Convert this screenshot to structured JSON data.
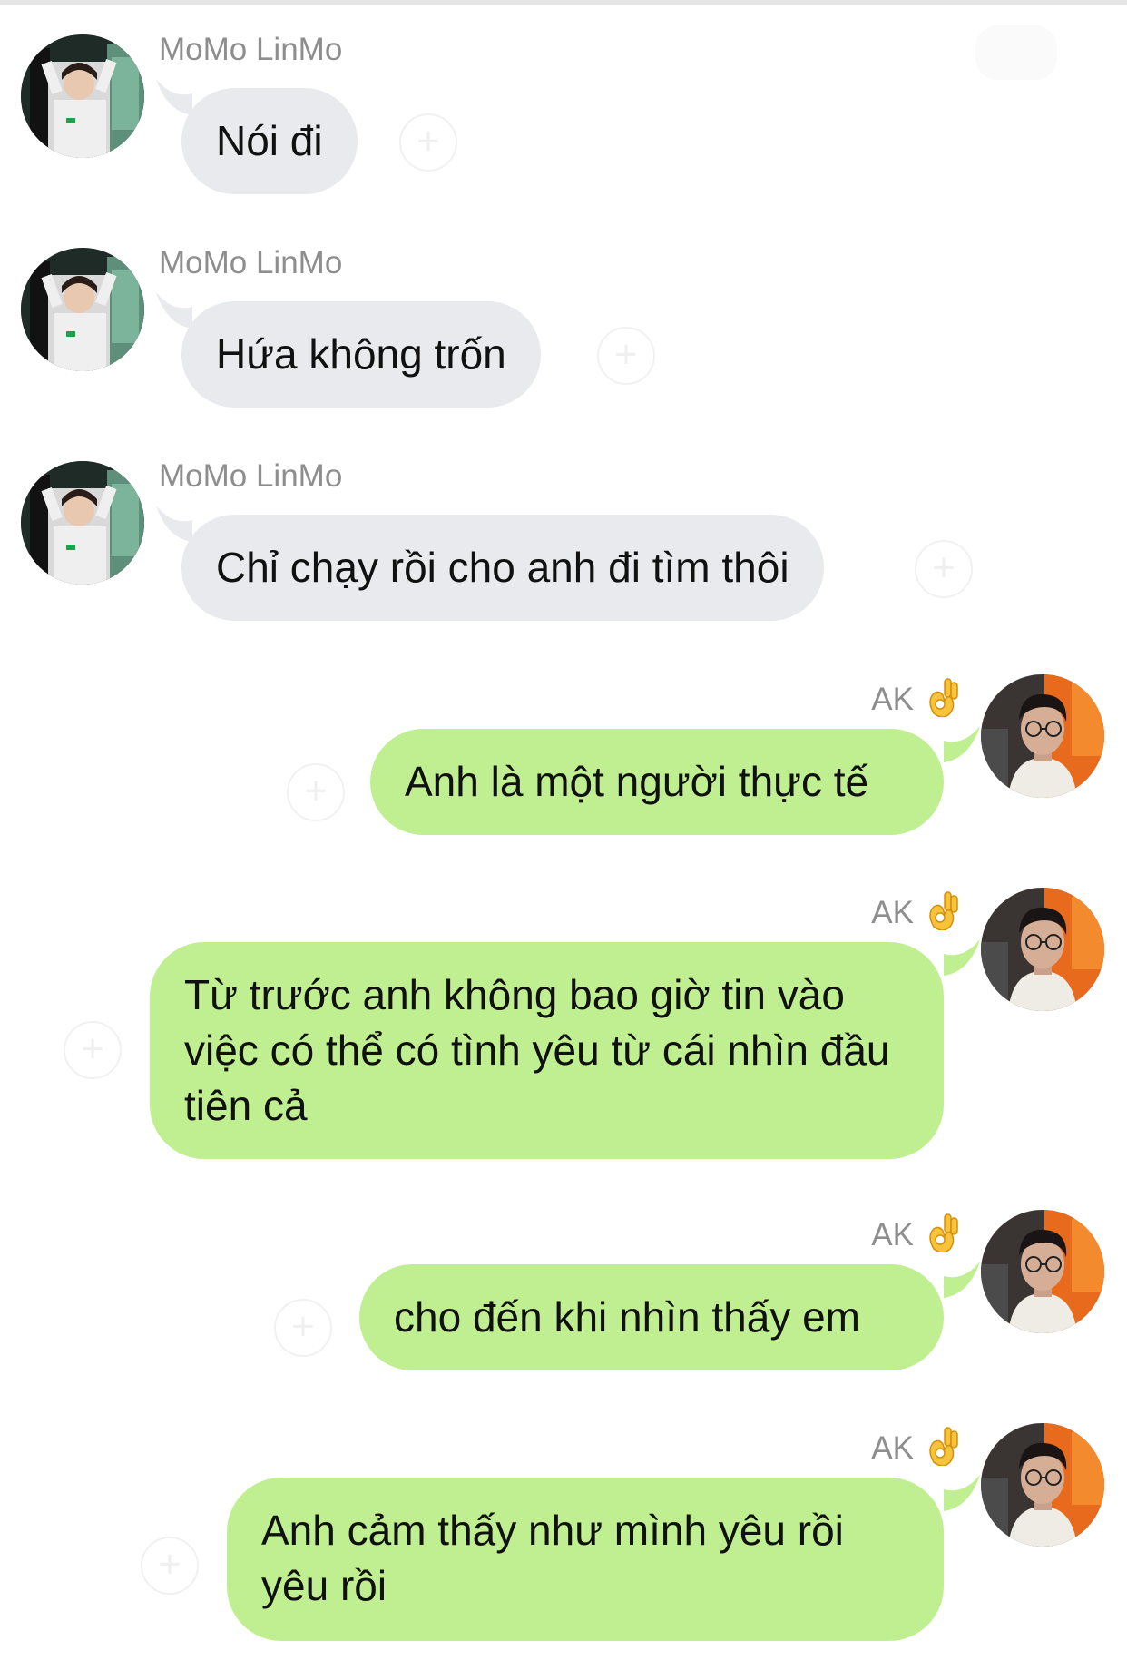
{
  "incoming_sender": "MoMo LinMo",
  "outgoing_sender": "AK",
  "sender_badge_icon": "ok-hand-emoji",
  "messages": [
    {
      "direction": "incoming",
      "text": "Nói đi"
    },
    {
      "direction": "incoming",
      "text": "Hứa không trốn"
    },
    {
      "direction": "incoming",
      "text": "Chỉ chạy rồi cho anh đi tìm thôi"
    },
    {
      "direction": "outgoing",
      "text": "Anh là một người thực tế"
    },
    {
      "direction": "outgoing",
      "text": "Từ trước anh không bao giờ tin vào việc có thể có tình yêu từ cái nhìn đầu tiên cả"
    },
    {
      "direction": "outgoing",
      "text": "cho đến khi nhìn thấy em"
    },
    {
      "direction": "outgoing",
      "text": "Anh cảm thấy như mình yêu rồi yêu rồi"
    }
  ],
  "colors": {
    "incoming_bubble": "#e9eaee",
    "outgoing_bubble": "#c0ef91",
    "sender_name": "#8e8e8e",
    "message_text": "#111111"
  }
}
